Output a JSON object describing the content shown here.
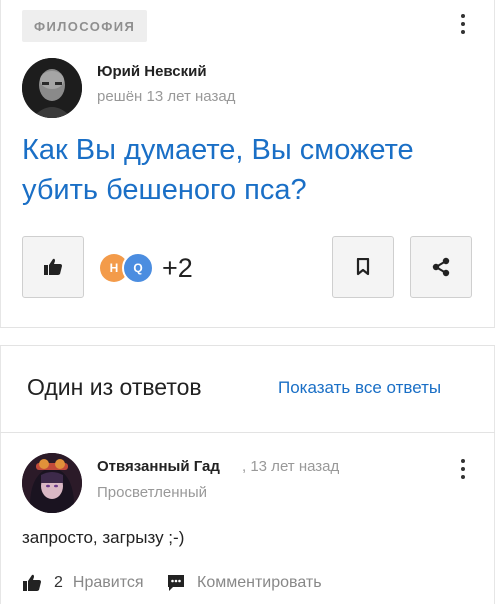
{
  "question": {
    "category": "ФИЛОСОФИЯ",
    "author_name": "Юрий Невский",
    "author_meta": "решён 13 лет назад",
    "title": "Как Вы думаете, Вы сможете убить бешеного пса?",
    "voter_initials": [
      "H",
      "Q"
    ],
    "voter_extra": "+2",
    "voter_colors": [
      "#f39b4a",
      "#4b8de0"
    ]
  },
  "answers_section": {
    "heading": "Один из ответов",
    "show_all_label": "Показать все ответы"
  },
  "answer": {
    "author_name": "Отвязанный Гад",
    "time": ", 13 лет назад",
    "rank": "Просветленный",
    "text": "запросто, загрызу ;-)",
    "like_count": "2",
    "like_label": "Нравится",
    "comment_label": "Комментировать"
  },
  "theme": {
    "accent": "#1a6fc6"
  }
}
